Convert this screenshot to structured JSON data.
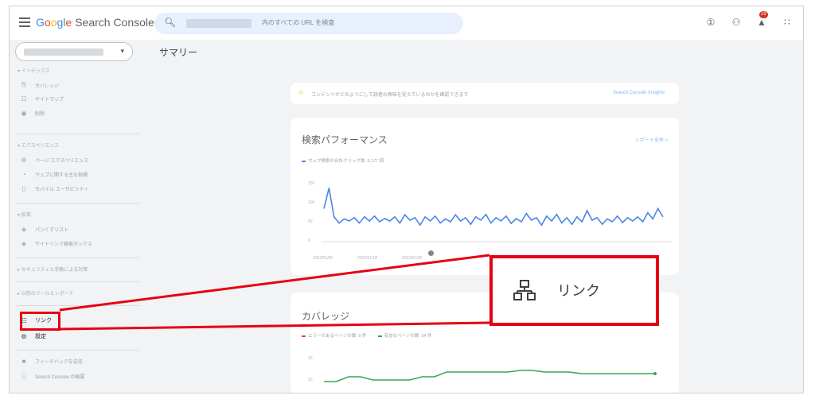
{
  "header": {
    "logo_google_letters": [
      "G",
      "o",
      "o",
      "g",
      "l",
      "e"
    ],
    "logo_product": "Search Console",
    "search_placeholder": "内のすべての URL を検査",
    "notification_count": "19",
    "icons": [
      "menu-icon",
      "search-icon",
      "help-icon",
      "account-icon",
      "bell-icon",
      "apps-grid-icon"
    ]
  },
  "page_title": "サマリー",
  "sidebar": {
    "sections": {
      "index": "インデックス",
      "experience": "エクスペリエンス",
      "enhancements": "拡張",
      "security": "セキュリティと手動による対策",
      "legacy": "以前のツールとレポート"
    },
    "items": {
      "coverage": "カバレッジ",
      "sitemaps": "サイトマップ",
      "removals": "削除",
      "page_experience": "ページ エクスペリエンス",
      "web_vitals": "ウェブに関する主な指標",
      "mobile_usability": "モバイル ユーザビリティ",
      "breadcrumbs": "パンくずリスト",
      "sitelinks_searchbox": "サイトリンク検索ボックス",
      "links": "リンク",
      "settings": "設定",
      "feedback": "フィードバックを送信",
      "about": "Search Console の概要"
    }
  },
  "insights_card": {
    "text": "コンテンツがどのようにして読者の興味を捉えているのかを確認できます",
    "link": "Search Console Insights"
  },
  "performance_card": {
    "title": "検索パフォーマンス",
    "report_link": "レポート全体 >",
    "legend": "ウェブ検索の合計クリック数: 6,177 回",
    "y_ticks": [
      "150",
      "100",
      "50",
      "0"
    ],
    "x_ticks": [
      "2022/01/06",
      "2022/01/18",
      "2022/01/30"
    ]
  },
  "coverage_card": {
    "title": "カバレッジ",
    "legend_error": "エラーのあるページの数: 0 件",
    "legend_valid": "有効なページの数: 24 件",
    "y_ticks": [
      "30",
      "20"
    ]
  },
  "callout": {
    "label": "リンク"
  },
  "colors": {
    "accent_red": "#e60012",
    "clicks_blue": "#4a86e8",
    "valid_green": "#34a853",
    "error_red": "#ea4335"
  },
  "chart_data": [
    {
      "type": "line",
      "title": "検索パフォーマンス",
      "xlabel": "",
      "ylabel": "",
      "ylim": [
        0,
        150
      ],
      "x_tick_labels": [
        "2022/01/06",
        "2022/01/18",
        "2022/01/30"
      ],
      "series": [
        {
          "name": "ウェブ検索の合計クリック数: 6,177 回",
          "color": "#4a86e8",
          "values": [
            80,
            130,
            60,
            45,
            55,
            50,
            58,
            45,
            60,
            50,
            62,
            48,
            56,
            50,
            60,
            45,
            65,
            52,
            58,
            40,
            60,
            50,
            62,
            45,
            55,
            48,
            65,
            50,
            58,
            42,
            60,
            52,
            66,
            45,
            58,
            50,
            62,
            44,
            56,
            48,
            68,
            52,
            58,
            40,
            62,
            50,
            66,
            45,
            58,
            42,
            60,
            48,
            75,
            52,
            58,
            42,
            55,
            48,
            62,
            46,
            58,
            50,
            60,
            48,
            70,
            55,
            80,
            60
          ]
        }
      ]
    },
    {
      "type": "line",
      "title": "カバレッジ",
      "xlabel": "",
      "ylabel": "",
      "ylim": [
        15,
        35
      ],
      "series": [
        {
          "name": "エラーのあるページの数: 0 件",
          "color": "#ea4335",
          "values": []
        },
        {
          "name": "有効なページの数: 24 件",
          "color": "#34a853",
          "values": [
            19,
            19,
            22,
            22,
            20,
            20,
            20,
            20,
            22,
            22,
            25,
            25,
            25,
            25,
            25,
            25,
            26,
            26,
            25,
            25,
            25,
            24,
            24,
            24,
            24,
            24,
            24,
            24
          ]
        }
      ]
    }
  ]
}
